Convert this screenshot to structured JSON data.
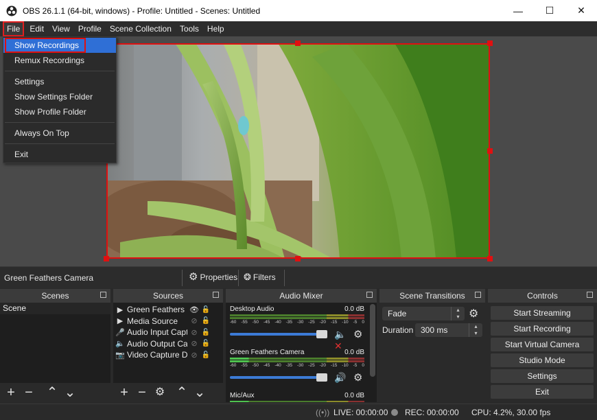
{
  "window": {
    "title": "OBS 26.1.1 (64-bit, windows) - Profile: Untitled - Scenes: Untitled",
    "minimize": "—",
    "maximize": "☐",
    "close": "✕"
  },
  "menubar": {
    "items": [
      {
        "label": "File",
        "active": true
      },
      {
        "label": "Edit"
      },
      {
        "label": "View"
      },
      {
        "label": "Profile"
      },
      {
        "label": "Scene Collection"
      },
      {
        "label": "Tools"
      },
      {
        "label": "Help"
      }
    ]
  },
  "file_menu": {
    "items": [
      "Show Recordings",
      "Remux Recordings",
      "Settings",
      "Show Settings Folder",
      "Show Profile Folder",
      "Always On Top",
      "Exit"
    ],
    "highlighted": "Show Recordings"
  },
  "source_toolbar": {
    "source_name": "Green Feathers Camera",
    "properties_label": "Properties",
    "filters_label": "Filters"
  },
  "scenes": {
    "title": "Scenes",
    "items": [
      "Scene"
    ]
  },
  "sources": {
    "title": "Sources",
    "items": [
      {
        "name": "Green Feathers Ca",
        "icon": "camera-play-icon",
        "visible": true
      },
      {
        "name": "Media Source",
        "icon": "play-icon",
        "visible": false
      },
      {
        "name": "Audio Input Captu",
        "icon": "microphone-icon",
        "visible": false
      },
      {
        "name": "Audio Output Cap",
        "icon": "speaker-icon",
        "visible": false
      },
      {
        "name": "Video Capture Dev",
        "icon": "camera-icon",
        "visible": false
      }
    ]
  },
  "audio_mixer": {
    "title": "Audio Mixer",
    "scale": [
      "-60",
      "-55",
      "-50",
      "-45",
      "-40",
      "-35",
      "-30",
      "-25",
      "-20",
      "-15",
      "-10",
      "-5",
      "0"
    ],
    "channels": [
      {
        "name": "Desktop Audio",
        "level": "0.0 dB",
        "muted": true,
        "volume": 1.0
      },
      {
        "name": "Green Feathers Camera",
        "level": "0.0 dB",
        "muted": false,
        "volume": 1.0
      },
      {
        "name": "Mic/Aux",
        "level": "0.0 dB",
        "muted": false,
        "volume": 1.0
      }
    ]
  },
  "scene_transitions": {
    "title": "Scene Transitions",
    "transition": "Fade",
    "duration_label": "Duration",
    "duration_value": "300 ms"
  },
  "controls": {
    "title": "Controls",
    "buttons": [
      "Start Streaming",
      "Start Recording",
      "Start Virtual Camera",
      "Studio Mode",
      "Settings",
      "Exit"
    ]
  },
  "status": {
    "live": "LIVE: 00:00:00",
    "rec": "REC: 00:00:00",
    "cpu": "CPU: 4.2%, 30.00 fps"
  },
  "colors": {
    "accent": "#2f6fd6",
    "highlight_box": "#e01010",
    "muted": "#e03030"
  }
}
